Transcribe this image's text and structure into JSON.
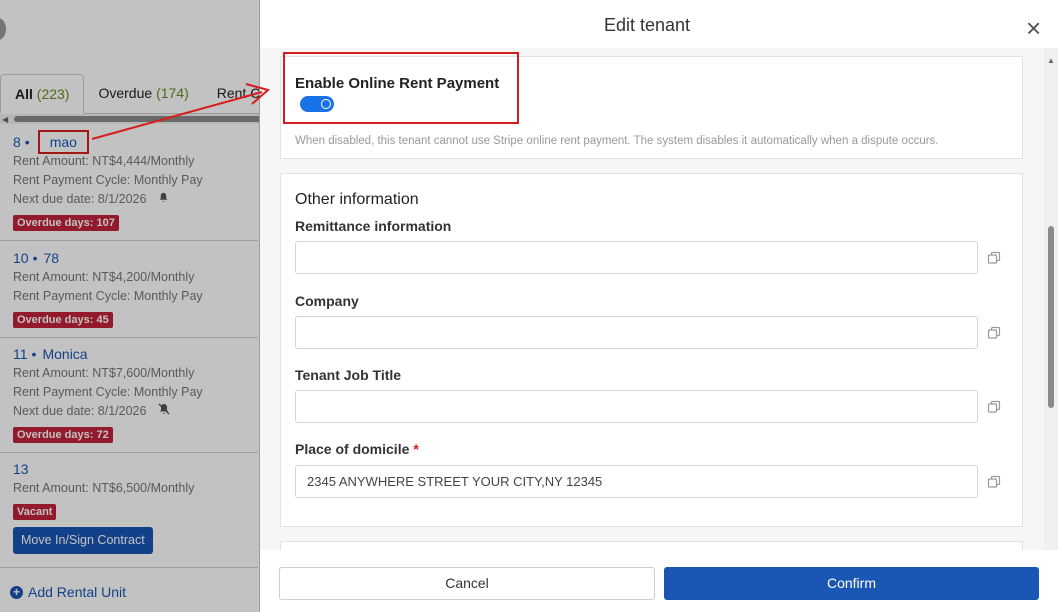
{
  "list": {
    "tabs": [
      {
        "label": "All",
        "count": "(223)"
      },
      {
        "label": "Overdue",
        "count": "(174)"
      },
      {
        "label": "Rent C",
        "count": ""
      }
    ],
    "units": [
      {
        "num": "8",
        "sep": "•",
        "name": "mao",
        "amount": "Rent Amount: NT$4,444/Monthly",
        "cycle": "Rent Payment Cycle: Monthly Pay",
        "due": "Next due date:  8/1/2026",
        "badge": "Overdue days: 107"
      },
      {
        "num": "10",
        "sep": "•",
        "name": "78",
        "amount": "Rent Amount: NT$4,200/Monthly",
        "cycle": "Rent Payment Cycle: Monthly Pay",
        "badge": "Overdue days: 45"
      },
      {
        "num": "11",
        "sep": "•",
        "name": "Monica",
        "amount": "Rent Amount: NT$7,600/Monthly",
        "cycle": "Rent Payment Cycle: Monthly Pay",
        "due": "Next due date:  8/1/2026",
        "badge": "Overdue days: 72"
      },
      {
        "num": "13",
        "amount": "Rent Amount: NT$6,500/Monthly",
        "badge": "Vacant",
        "action": "Move In/Sign Contract"
      }
    ],
    "add_unit": "Add Rental Unit"
  },
  "modal": {
    "title": "Edit tenant",
    "close": "×",
    "online_payment": {
      "title": "Enable Online Rent Payment",
      "enabled": true,
      "description": "When disabled, this tenant cannot use Stripe online rent payment. The system disables it automatically when a dispute occurs."
    },
    "other_info": {
      "title": "Other information",
      "fields": [
        {
          "label": "Remittance information",
          "value": "",
          "required": false
        },
        {
          "label": "Company",
          "value": "",
          "required": false
        },
        {
          "label": "Tenant Job Title",
          "value": "",
          "required": false
        },
        {
          "label": "Place of domicile",
          "value": "2345 ANYWHERE STREET YOUR CITY,NY 12345",
          "required": true,
          "required_mark": "*"
        }
      ]
    },
    "footer": {
      "cancel": "Cancel",
      "confirm": "Confirm"
    }
  },
  "colors": {
    "primary": "#1a56b4",
    "toggle": "#1a72e8",
    "badge": "#c0233a",
    "annotation": "#d71e1e"
  },
  "icons": [
    "bell-icon",
    "bell-off-icon",
    "plus-circle-icon",
    "close-icon",
    "copy-icon"
  ]
}
